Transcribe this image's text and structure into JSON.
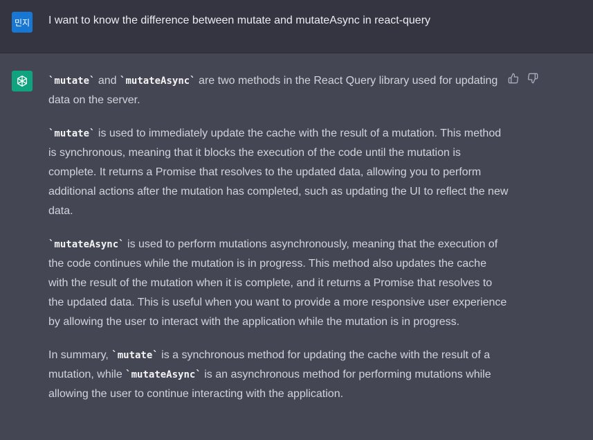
{
  "user_message": {
    "avatar_text": "민지",
    "text": "I want to know the difference between mutate and mutateAsync in react-query"
  },
  "assistant_message": {
    "paragraphs": [
      [
        {
          "code": "`mutate`"
        },
        {
          "text": " and "
        },
        {
          "code": "`mutateAsync`"
        },
        {
          "text": " are two methods in the React Query library used for updating data on the server."
        }
      ],
      [
        {
          "code": "`mutate`"
        },
        {
          "text": " is used to immediately update the cache with the result of a mutation. This method is synchronous, meaning that it blocks the execution of the code until the mutation is complete. It returns a Promise that resolves to the updated data, allowing you to perform additional actions after the mutation has completed, such as updating the UI to reflect the new data."
        }
      ],
      [
        {
          "code": "`mutateAsync`"
        },
        {
          "text": " is used to perform mutations asynchronously, meaning that the execution of the code continues while the mutation is in progress. This method also updates the cache with the result of the mutation when it is complete, and it returns a Promise that resolves to the updated data. This is useful when you want to provide a more responsive user experience by allowing the user to interact with the application while the mutation is in progress."
        }
      ],
      [
        {
          "text": "In summary, "
        },
        {
          "code": "`mutate`"
        },
        {
          "text": " is a synchronous method for updating the cache with the result of a mutation, while "
        },
        {
          "code": "`mutateAsync`"
        },
        {
          "text": " is an asynchronous method for performing mutations while allowing the user to continue interacting with the application."
        }
      ]
    ]
  },
  "feedback": {
    "thumbs_up_icon": "thumbs-up-icon",
    "thumbs_down_icon": "thumbs-down-icon"
  },
  "colors": {
    "user_bg": "#343541",
    "assistant_bg": "#444654",
    "user_avatar": "#1877d2",
    "assistant_avatar": "#10a37f",
    "text": "#d1d5db"
  }
}
